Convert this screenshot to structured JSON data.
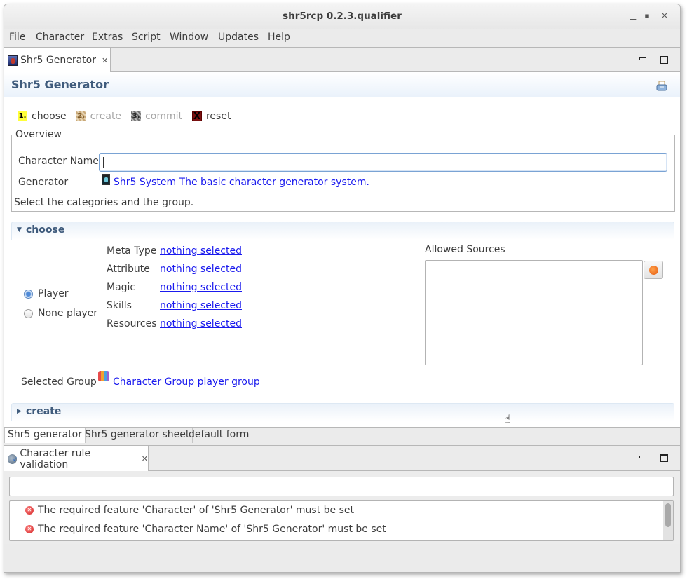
{
  "window": {
    "title": "shr5rcp 0.2.3.qualifier",
    "controls": [
      "minimize",
      "maximize",
      "close"
    ]
  },
  "menu": [
    "File",
    "Character",
    "Extras",
    "Script",
    "Window",
    "Updates",
    "Help"
  ],
  "editor": {
    "tab_label": "Shr5 Generator",
    "form_title": "Shr5 Generator",
    "steps": [
      {
        "number": "1.",
        "label": "choose",
        "enabled": true
      },
      {
        "number": "2.",
        "label": "create",
        "enabled": false
      },
      {
        "number": "3.",
        "label": "commit",
        "enabled": false
      },
      {
        "number": "X",
        "label": "reset",
        "enabled": true
      }
    ],
    "overview": {
      "legend": "Overview",
      "character_name_label": "Character Name",
      "character_name_value": "",
      "generator_label": "Generator",
      "generator_link": "Shr5 System The basic character generator system.",
      "hint": "Select the categories and the group."
    },
    "choose_section": {
      "title": "choose",
      "expanded": true,
      "player_options": [
        {
          "label": "Player",
          "selected": true
        },
        {
          "label": "None player",
          "selected": false
        }
      ],
      "categories": [
        {
          "label": "Meta Type",
          "value": "nothing selected"
        },
        {
          "label": "Attribute",
          "value": "nothing selected"
        },
        {
          "label": "Magic",
          "value": "nothing selected"
        },
        {
          "label": "Skills",
          "value": "nothing selected"
        },
        {
          "label": "Resources",
          "value": "nothing selected"
        }
      ],
      "allowed_sources_label": "Allowed Sources",
      "allowed_sources": [],
      "selected_group_label": "Selected Group",
      "selected_group_link": "Character Group player group"
    },
    "create_section": {
      "title": "create",
      "expanded": false
    },
    "bottom_tabs": [
      {
        "label": "Shr5 generator",
        "active": true
      },
      {
        "label": "Shr5 generator sheet",
        "active": false
      },
      {
        "label": "default form",
        "active": false
      }
    ]
  },
  "validation": {
    "tab_label": "Character rule validation",
    "filter_value": "",
    "messages": [
      {
        "severity": "error",
        "text": "The required feature 'Character' of 'Shr5 Generator' must be set"
      },
      {
        "severity": "error",
        "text": "The required feature 'Character Name' of 'Shr5 Generator' must be set"
      }
    ]
  },
  "colors": {
    "form_title": "#3f5b7c",
    "link": "#1a1aee",
    "step1_badge": "#ffff3a",
    "error": "#d21d1d"
  }
}
